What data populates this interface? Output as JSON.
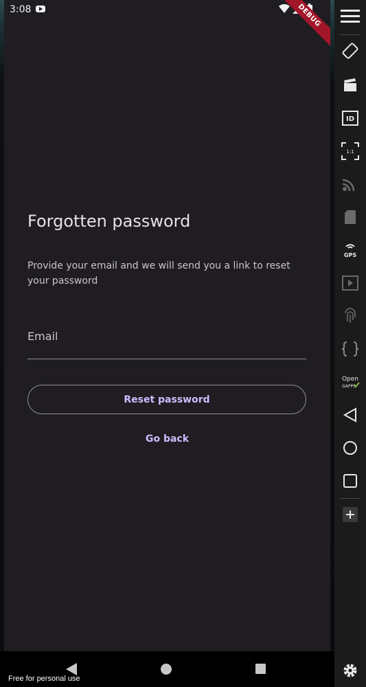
{
  "status_bar": {
    "time": "3:08"
  },
  "debug_banner": "DEBUG",
  "screen": {
    "title": "Forgotten password",
    "subtitle": "Provide your email and we will send you a link to reset your password",
    "email_field": {
      "placeholder": "Email",
      "value": ""
    },
    "reset_button_label": "Reset password",
    "go_back_label": "Go back"
  },
  "emulator_toolbar": {
    "items": [
      {
        "name": "menu-icon"
      },
      {
        "name": "rotate-icon"
      },
      {
        "name": "screenrecord-icon"
      },
      {
        "name": "id-icon",
        "label": "ID"
      },
      {
        "name": "fullscreen-icon",
        "label": "1:1"
      },
      {
        "name": "cast-icon"
      },
      {
        "name": "sd-card-icon"
      },
      {
        "name": "gps-icon",
        "label": "GPS"
      },
      {
        "name": "media-icon"
      },
      {
        "name": "fingerprint-icon"
      },
      {
        "name": "code-braces-icon",
        "label": "{ }"
      },
      {
        "name": "opengapps-icon",
        "label": "Open GAPPS"
      },
      {
        "name": "back-icon"
      },
      {
        "name": "home-icon"
      },
      {
        "name": "overview-icon"
      },
      {
        "name": "add-icon",
        "label": "+"
      },
      {
        "name": "settings-icon"
      }
    ]
  },
  "watermark": "Free for personal use",
  "colors": {
    "background": "#1f1d22",
    "primary": "#cfbcff",
    "outline": "#938f99",
    "on_surface": "#e6e1e6",
    "debug_ribbon": "#a3162a"
  }
}
